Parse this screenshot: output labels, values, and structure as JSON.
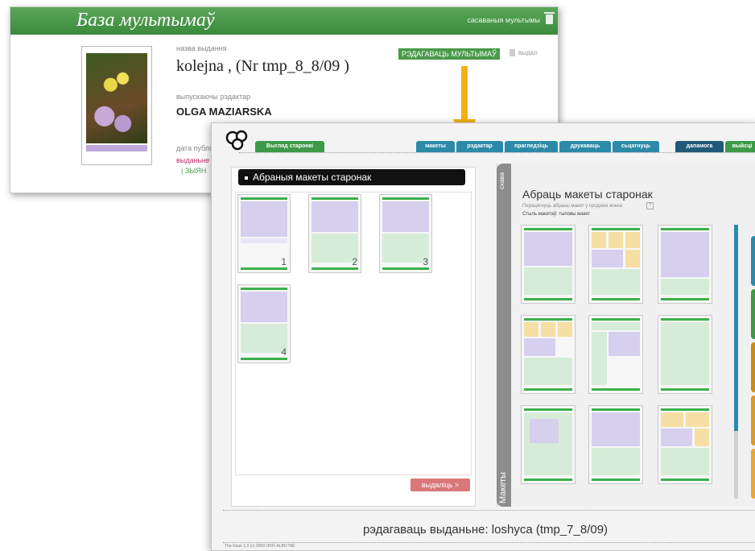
{
  "back": {
    "title": "База мультымаў",
    "saved": "сасаваныя мультымы",
    "label_title": "назва выдання",
    "name": "kolejna , (Nr tmp_8_8/09 )",
    "label_publisher": "выпускаючы рэдактар",
    "publisher": "OLGA MAZIARSKA",
    "label_date": "дата публі",
    "link_red": "выданьне с",
    "link_green": "| ЗЫЯН",
    "edit_button": "РЭДАГАВАЦЬ МУЛЬТЫМАЎ",
    "delete": "выдал"
  },
  "front": {
    "tabs": [
      {
        "label": "Выгляд старонкі"
      },
      {
        "label": "макеты"
      },
      {
        "label": "рэдактар"
      },
      {
        "label": "прагледзіць"
      },
      {
        "label": "друкаваць"
      },
      {
        "label": "сьцягнуць"
      },
      {
        "label": "дапамога"
      },
      {
        "label": "выйсці"
      }
    ],
    "selected_header": "Абраныя макеты старонак",
    "selected_pages": [
      "1",
      "2",
      "3",
      "4"
    ],
    "next_button": "выдаліць >",
    "right_title": "Абраць макеты старонак",
    "right_hint": "Перацягнуць абраны макет у сродзіне вокна",
    "right_style": "Стыль макетаў: тыповы макет",
    "vertical_top": "схава",
    "vertical_bottom": "Макеты",
    "edit_title": "рэдагаваць выданьне: loshyca (tmp_7_8/09)",
    "footer": "The Issue 1.0 (c) 2009 ORFI ALBO NIE"
  },
  "colors": {
    "green": "#3e9a48",
    "blue": "#2c8aa8",
    "navy": "#1f5a78",
    "arrow": "#f2b215",
    "lavender": "#d6d0ee",
    "mint": "#d6ecd8",
    "yellow": "#f6dfa4"
  }
}
